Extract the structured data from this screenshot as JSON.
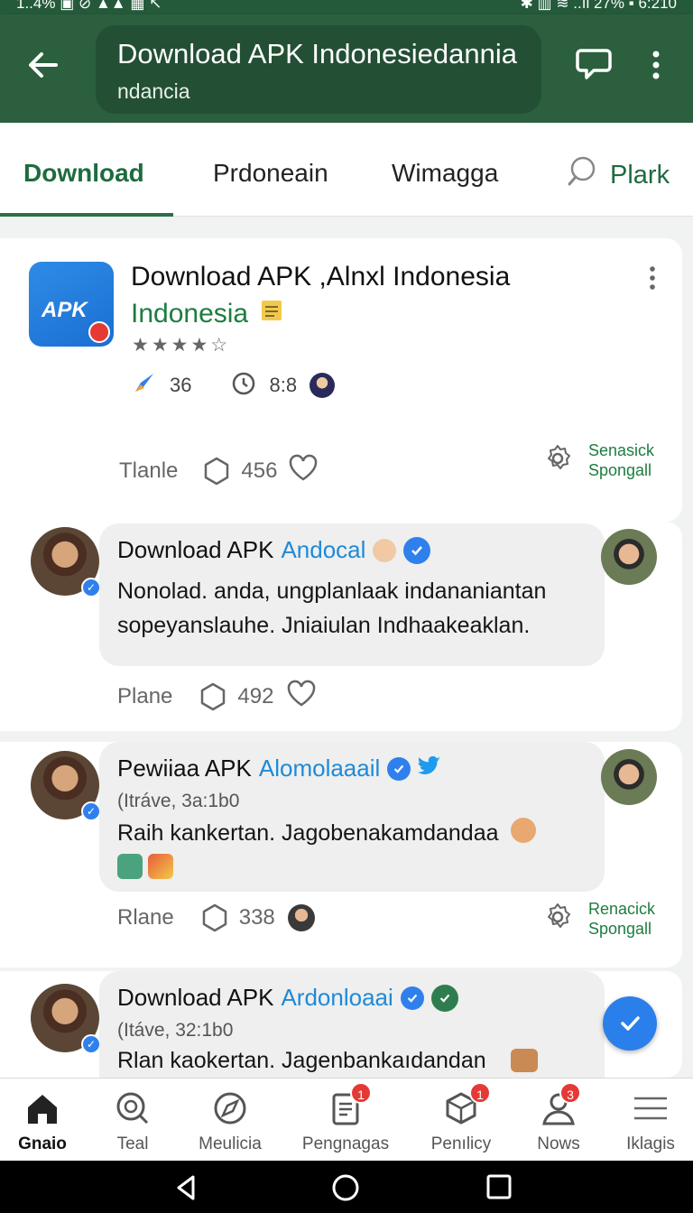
{
  "status_bar": {
    "left": "1..4% ▣ ⊘ ▲▲ ▦ ↖",
    "right": "✱ ▥ ≋ ..ıl 27% ▪ 6:210"
  },
  "app_bar": {
    "title": "Download APK Indonesiedannia",
    "subtitle": "ndancia"
  },
  "tabs": [
    {
      "label": "Download"
    },
    {
      "label": "Prdoneain"
    },
    {
      "label": "Wimagga"
    },
    {
      "label": "Plark"
    }
  ],
  "app_card": {
    "title_line1": "Download APK ,Alnxl Indonesia",
    "title_line2": "Indonesia",
    "icon_label": "APK",
    "stars": "★★★★☆",
    "meta": [
      {
        "value": "36"
      },
      {
        "value": "8:8"
      }
    ],
    "action_label": "Tlanle",
    "share_count": "456",
    "sponsor": [
      "Senasick",
      "Spongall"
    ]
  },
  "posts": [
    {
      "name": "Download APK",
      "account": "Andocal",
      "text_line1": "Nonolad. anda, ungplanlaak indananiantan",
      "text_line2": "sopeyanslauhe. Jniaiulan Indhaakeaklan.",
      "action_label": "Plane",
      "share_count": "492"
    },
    {
      "name": "Pewiiaa APK",
      "account": "Alomolaaail",
      "meta": "(Itráve, 3a:1b0",
      "text_line1": "Raih kankertan. Jagobenakamdandaa",
      "action_label": "Rlane",
      "share_count": "338",
      "sponsor": [
        "Renacick",
        "Spongall"
      ]
    },
    {
      "name": "Download APK",
      "account": "Ardonloaai",
      "meta": "(Itáve, 32:1b0",
      "text_line1": "Rlan kaokertan. Jagenbankaıdandan"
    }
  ],
  "bottom_nav": [
    {
      "label": "Gnaio",
      "badge": ""
    },
    {
      "label": "Teal",
      "badge": ""
    },
    {
      "label": "Meulicia",
      "badge": ""
    },
    {
      "label": "Pengnagas",
      "badge": "1"
    },
    {
      "label": "Penılicy",
      "badge": "1"
    },
    {
      "label": "Nows",
      "badge": "3"
    },
    {
      "label": "Iklagis",
      "badge": ""
    }
  ],
  "colors": {
    "app_bar": "#2b5f3e",
    "accent_green": "#1e6b3f",
    "link_blue": "#1f8ad8",
    "verified_blue": "#2f80ed",
    "badge_red": "#e53935"
  }
}
